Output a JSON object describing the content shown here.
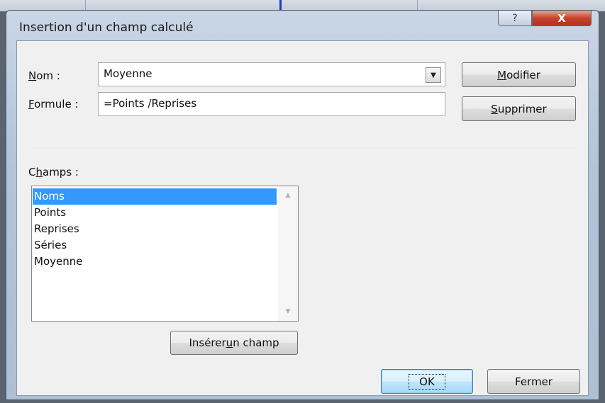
{
  "dialog": {
    "title": "Insertion d'un champ calculé",
    "help_glyph": "?",
    "close_glyph": "X"
  },
  "nom": {
    "label_accel": "N",
    "label_rest": "om :",
    "value": "Moyenne",
    "dropdown_glyph": "▼"
  },
  "formule": {
    "label_accel": "F",
    "label_rest": "ormule :",
    "value": "=Points /Reprises"
  },
  "buttons": {
    "modifier_accel": "M",
    "modifier_rest": "odifier",
    "supprimer_accel": "S",
    "supprimer_rest": "upprimer",
    "inserer_pre": "Insérer ",
    "inserer_accel": "u",
    "inserer_post": "n champ",
    "ok": "OK",
    "fermer": "Fermer"
  },
  "champs": {
    "label_pre": "C",
    "label_accel": "h",
    "label_post": "amps :",
    "items": [
      {
        "label": "Noms",
        "selected": true
      },
      {
        "label": "Points",
        "selected": false
      },
      {
        "label": "Reprises",
        "selected": false
      },
      {
        "label": "Séries",
        "selected": false
      },
      {
        "label": "Moyenne",
        "selected": false
      }
    ],
    "scroll_up_glyph": "▲",
    "scroll_down_glyph": "▼"
  },
  "colors": {
    "selection": "#3399ff",
    "close_button": "#c7432c",
    "default_button_border": "#3c7fb1"
  }
}
